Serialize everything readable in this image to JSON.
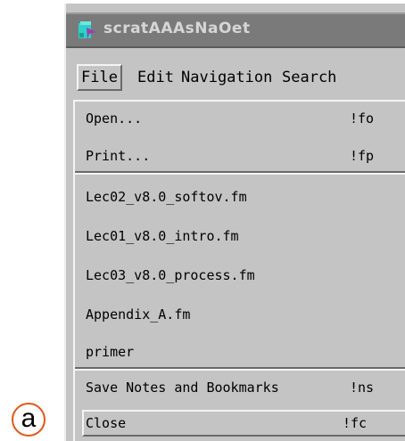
{
  "window": {
    "title": "scratAAAsNaOet"
  },
  "menubar": {
    "items": [
      {
        "label": "File",
        "active": true
      },
      {
        "label": "Edit",
        "active": false
      },
      {
        "label": "Navigation",
        "active": false
      },
      {
        "label": "Search",
        "active": false
      }
    ]
  },
  "file_menu": {
    "open": {
      "label": "Open...",
      "accel": "!fo"
    },
    "print": {
      "label": "Print...",
      "accel": "!fp"
    },
    "recent_files": [
      "Lec02_v8.0_softov.fm",
      "Lec01_v8.0_intro.fm",
      "Lec03_v8.0_process.fm",
      "Appendix_A.fm",
      "primer"
    ],
    "save_notes": {
      "label": "Save Notes and Bookmarks",
      "accel": "!ns"
    },
    "close": {
      "label": "Close",
      "accel": "!fc"
    }
  },
  "annotation": {
    "label": "a",
    "color": "#e0561c"
  },
  "colors": {
    "menu_bg": "#c4c4c4",
    "titlebar_bg": "#7a7a7a",
    "icon_cyan": "#2fd0c8",
    "icon_purple": "#9a3fb0"
  }
}
